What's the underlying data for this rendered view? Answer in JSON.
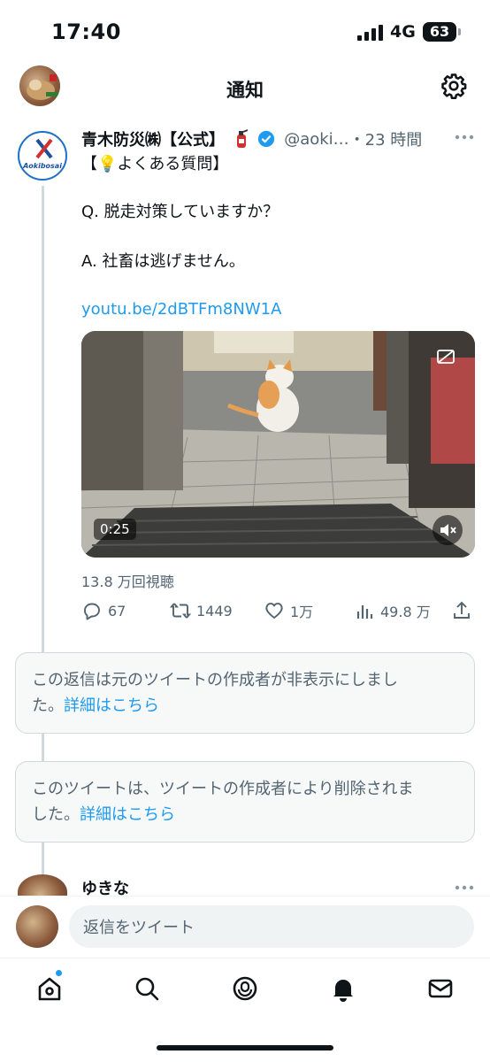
{
  "status_bar": {
    "time": "17:40",
    "network": "4G",
    "battery": "63"
  },
  "header": {
    "title": "通知",
    "settings_icon": "gear-icon"
  },
  "tweet": {
    "author_name": "青木防災㈱【公式】",
    "handle": "@aoki…",
    "time": "・23 時間",
    "text_line1": "【💡よくある質問】",
    "text_line2": "Q. 脱走対策していますか？",
    "text_line3": "A. 社畜は逃げません。",
    "link": "youtu.be/2dBTFm8NW1A",
    "avatar_logo": "Aokibosai",
    "video": {
      "duration": "0:25"
    },
    "views": "13.8 万回視聴",
    "actions": {
      "replies": "67",
      "retweets": "1449",
      "likes": "1万",
      "analytics": "49.8 万"
    }
  },
  "notices": [
    {
      "text": "この返信は元のツイートの作成者が非表示にしまし",
      "text2": "た。",
      "link": "詳細はこちら"
    },
    {
      "text": "このツイートは、ツイートの作成者により削除されま",
      "text2": "した。",
      "link": "詳細はこちら"
    }
  ],
  "next_tweet": {
    "author_name": "ゆきな"
  },
  "reply_bar": {
    "placeholder": "返信をツイート"
  },
  "tab_bar": {
    "items": [
      "home-icon",
      "search-icon",
      "spaces-icon",
      "notifications-icon",
      "messages-icon"
    ]
  },
  "colors": {
    "accent": "#1d9bf0",
    "text": "#0f1419",
    "muted": "#536471",
    "border": "#cfd9de"
  }
}
